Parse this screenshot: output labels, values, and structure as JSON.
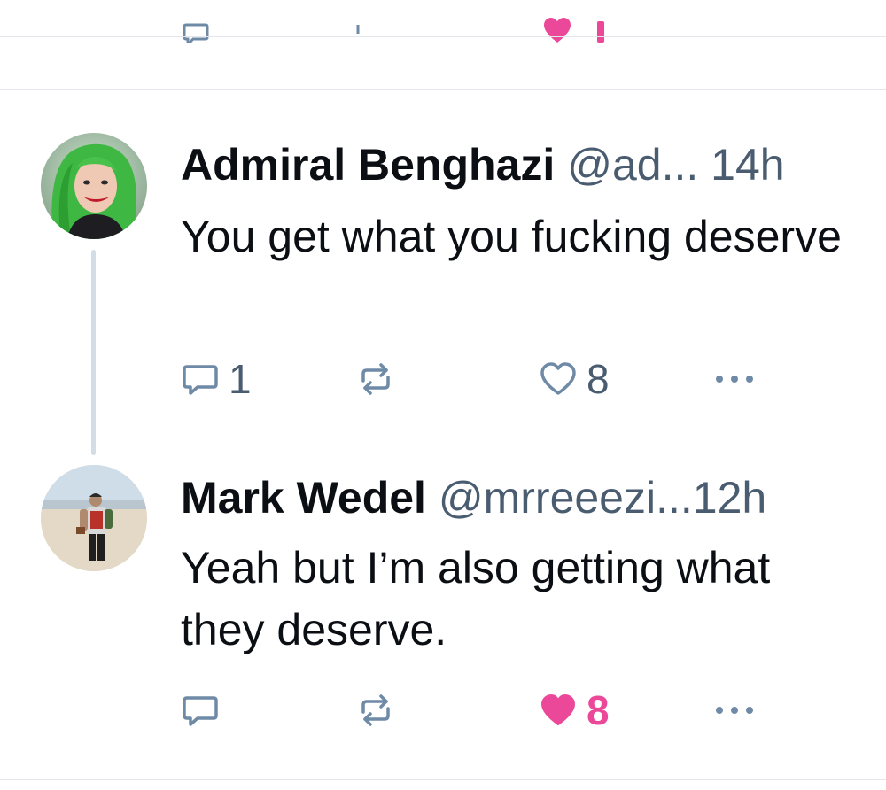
{
  "posts": [
    {
      "author_name": "Admiral Benghazi",
      "handle": "@ad...",
      "time": "14h",
      "text": "You get what you fucking deserve",
      "reply_count": "1",
      "like_count": "8",
      "liked": false,
      "more_label": "•••"
    },
    {
      "author_name": "Mark Wedel",
      "handle": "@mrreeezi...",
      "time": "12h",
      "text": "Yeah but I’m also getting what they deserve.",
      "reply_count": "",
      "like_count": "8",
      "liked": true,
      "more_label": "•••"
    }
  ],
  "colors": {
    "like_active": "#ec4899",
    "muted": "#4a5c70",
    "icon": "#6f8aa6",
    "thread_line": "#d3dde6",
    "divider": "#e3e7eb"
  },
  "icons": [
    "reply-icon",
    "repost-icon",
    "heart-icon",
    "more-icon",
    "avatar-image"
  ]
}
